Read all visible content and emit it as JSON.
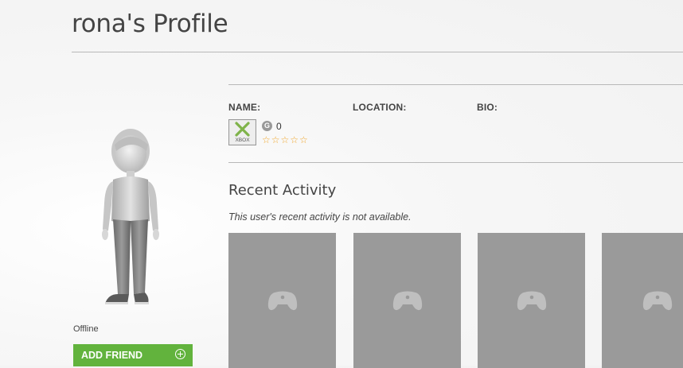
{
  "page": {
    "title": "rona's Profile"
  },
  "profile": {
    "status": "Offline",
    "add_friend_label": "ADD FRIEND",
    "fields": {
      "name_label": "NAME:",
      "location_label": "LOCATION:",
      "bio_label": "BIO:"
    },
    "gamerpic_text": "XBOX",
    "gamerscore_icon": "G",
    "gamerscore": "0",
    "reputation": "☆☆☆☆☆"
  },
  "recent_activity": {
    "title": "Recent Activity",
    "note": "This user's recent activity is not available.",
    "tiles": [
      {
        "icon": "controller-icon"
      },
      {
        "icon": "controller-icon"
      },
      {
        "icon": "controller-icon"
      },
      {
        "icon": "controller-icon"
      }
    ]
  },
  "colors": {
    "accent_green": "#62b33d",
    "star_orange": "#f0a52a",
    "tile_gray": "#9a9a9a"
  }
}
